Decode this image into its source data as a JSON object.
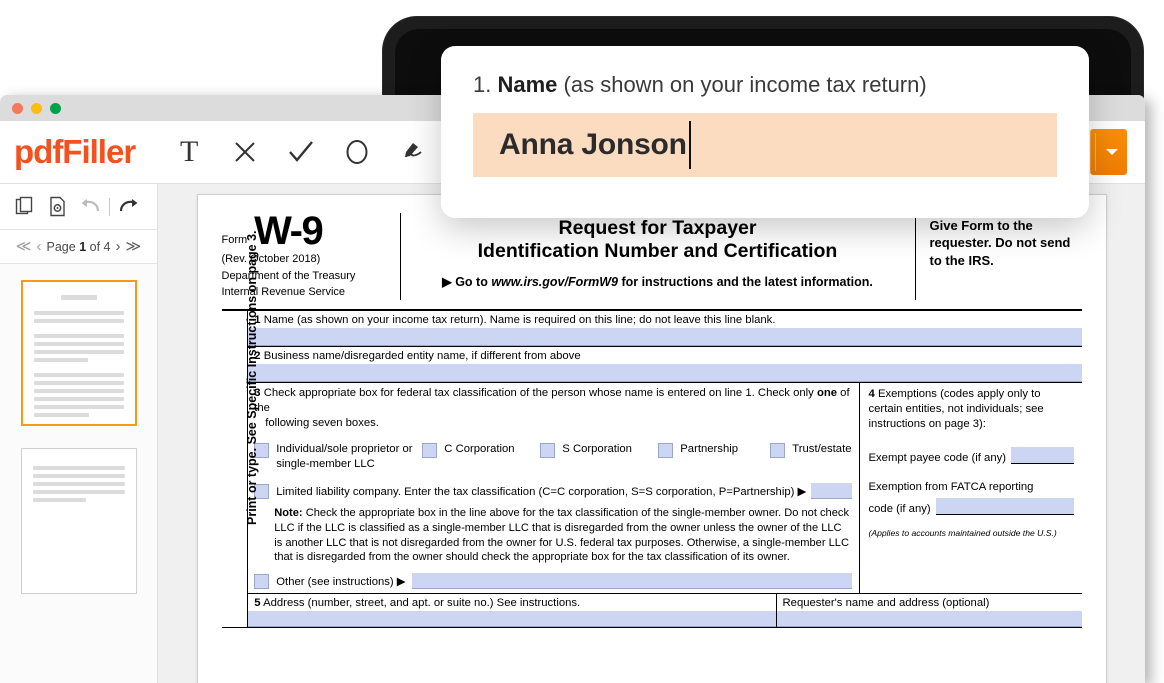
{
  "window": {
    "dots": [
      "close",
      "minimize",
      "maximize"
    ]
  },
  "header": {
    "logo": "pdfFiller",
    "tools": [
      {
        "name": "text-tool",
        "glyph": "T"
      },
      {
        "name": "cross-tool",
        "glyph": "✕"
      },
      {
        "name": "check-tool",
        "glyph": "✓"
      },
      {
        "name": "circle-tool",
        "glyph": "O"
      },
      {
        "name": "sign-tool",
        "glyph": "sign"
      }
    ],
    "primary_button": "dropdown",
    "accent_color": "#f4511e",
    "button_color": "#f4900a"
  },
  "sidebar": {
    "tools": [
      {
        "name": "copy-pages-icon"
      },
      {
        "name": "page-settings-icon"
      },
      {
        "name": "undo-icon"
      },
      {
        "name": "redo-icon"
      }
    ],
    "pager": {
      "first": "≪",
      "prev": "‹",
      "label_prefix": "Page",
      "current_page": "1",
      "label_middle": "of",
      "total_pages": "4",
      "next": "›",
      "last": "≫"
    },
    "thumbnails": [
      {
        "page": "1",
        "active": true
      },
      {
        "page": "2",
        "active": false
      }
    ]
  },
  "popup": {
    "number": "1.",
    "label_bold": "Name",
    "label_rest": "(as shown on your income tax return)",
    "value": "Anna Jonson",
    "field_color": "#fbdcc0"
  },
  "form": {
    "header": {
      "form_word": "Form",
      "form_number": "W-9",
      "revision": "(Rev. October 2018)",
      "dept1": "Department of the Treasury",
      "dept2": "Internal Revenue Service",
      "title_line1": "Request for Taxpayer",
      "title_line2": "Identification Number and Certification",
      "goto_prefix": "▶ Go to",
      "goto_url": "www.irs.gov/FormW9",
      "goto_suffix": "for instructions and the latest information.",
      "give_form": "Give Form to the requester. Do not send to the IRS."
    },
    "vertical_note": "Print or type. See Specific Instructions on page 3.",
    "line1": {
      "num": "1",
      "label": "Name (as shown on your income tax return). Name is required on this line; do not leave this line blank."
    },
    "line2": {
      "num": "2",
      "label": "Business name/disregarded entity name, if different from above"
    },
    "line3": {
      "num": "3",
      "text_a": "Check appropriate box for federal tax classification of the person whose name is entered on line 1. Check only",
      "text_bold": "one",
      "text_b": "of the",
      "text_c": "following seven boxes.",
      "checkboxes": [
        "Individual/sole proprietor or single-member LLC",
        "C Corporation",
        "S Corporation",
        "Partnership",
        "Trust/estate"
      ],
      "llc_label": "Limited liability company. Enter the tax classification (C=C corporation, S=S corporation, P=Partnership) ▶",
      "note_bold": "Note:",
      "note_text": "Check the appropriate box in the line above for the tax classification of the single-member owner.  Do not check LLC if the LLC is classified as a single-member LLC that is disregarded from the owner unless the owner of the LLC is another LLC that is not disregarded from the owner for U.S. federal tax purposes. Otherwise, a single-member LLC that is disregarded from the owner should check the appropriate box for the tax classification of its owner.",
      "other_label": "Other (see instructions) ▶"
    },
    "line4": {
      "num": "4",
      "label": "Exemptions (codes apply only to certain entities, not individuals; see instructions on page 3):",
      "exempt_payee": "Exempt payee code (if any)",
      "fatca_line1": "Exemption from FATCA reporting",
      "fatca_line2": "code (if any)",
      "applies": "(Applies to accounts maintained outside the U.S.)"
    },
    "line5": {
      "num": "5",
      "label": "Address (number, street, and apt. or suite no.) See instructions.",
      "requester": "Requester's name and address (optional)"
    },
    "field_color": "#ccd5f2"
  }
}
